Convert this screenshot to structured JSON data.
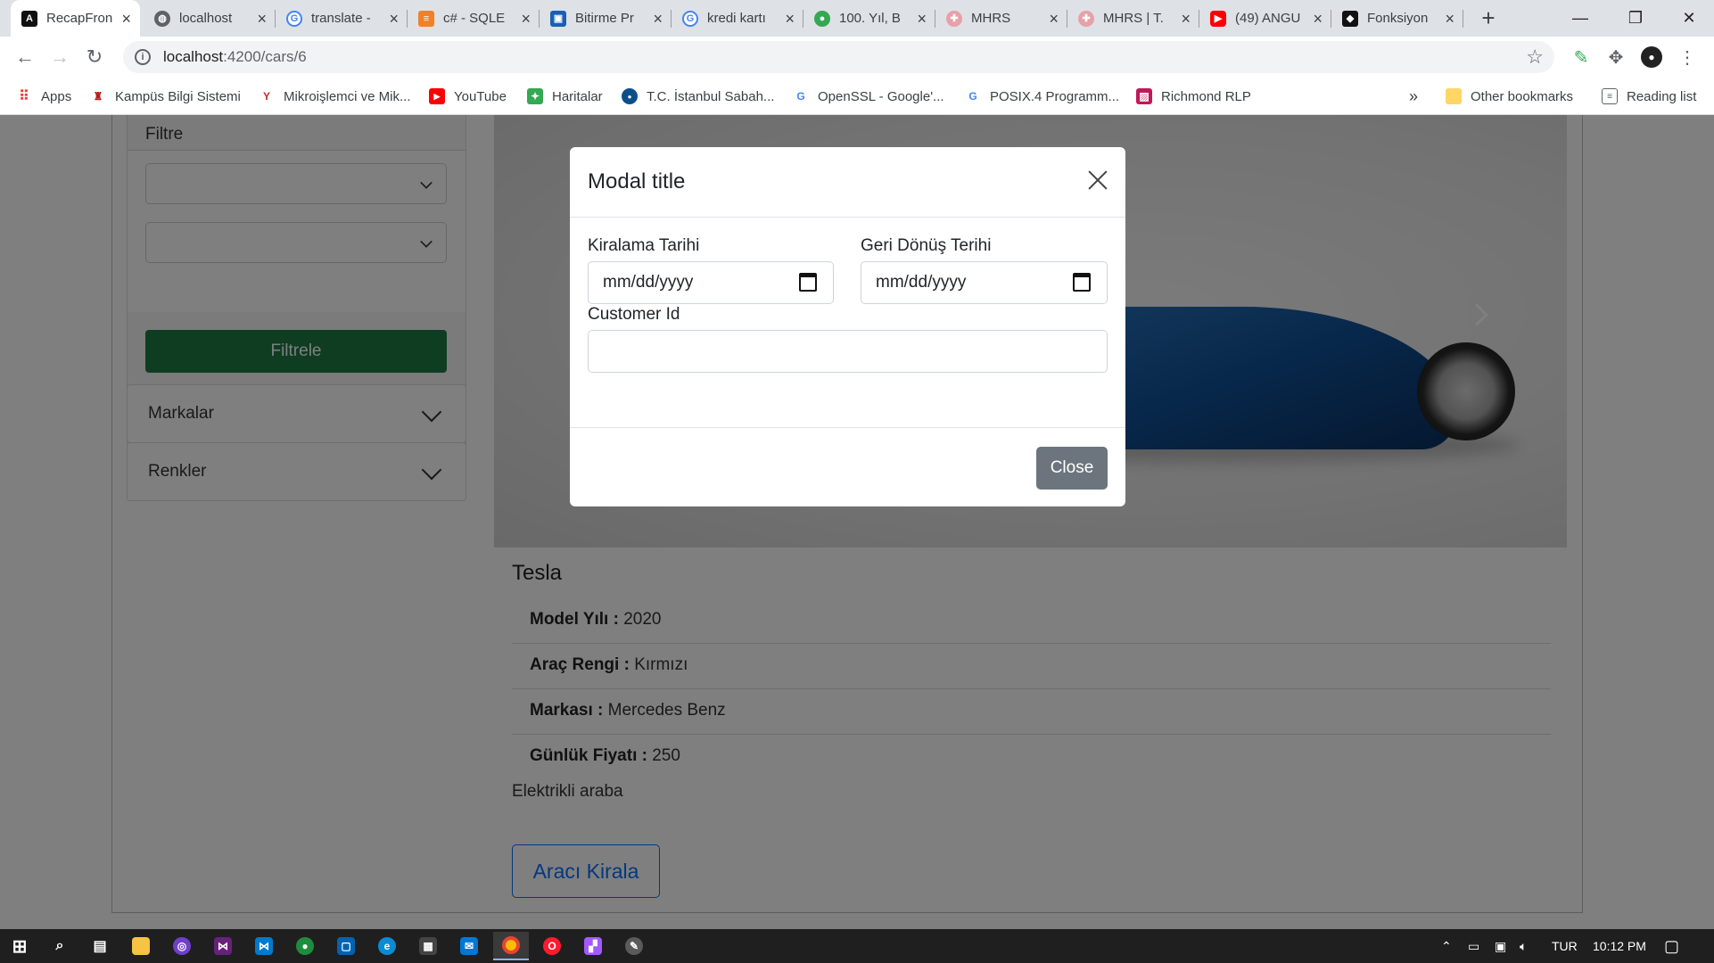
{
  "browser": {
    "tabs": [
      {
        "title": "RecapFron",
        "icon": "angular-icon",
        "active": true
      },
      {
        "title": "localhost",
        "icon": "globe-icon"
      },
      {
        "title": "translate -",
        "icon": "google-icon"
      },
      {
        "title": "c# - SQLE",
        "icon": "stackoverflow-icon"
      },
      {
        "title": "Bitirme Pr",
        "icon": "document-icon"
      },
      {
        "title": "kredi kartı",
        "icon": "google-icon"
      },
      {
        "title": "100. Yıl, B",
        "icon": "maps-pin-icon"
      },
      {
        "title": "MHRS",
        "icon": "mhrs-icon"
      },
      {
        "title": "MHRS | T.",
        "icon": "mhrs-icon"
      },
      {
        "title": "(49) ANGU",
        "icon": "youtube-icon"
      },
      {
        "title": "Fonksiyon",
        "icon": "site-icon"
      }
    ],
    "url_host": "localhost",
    "url_path": ":4200/cars/6",
    "bookmarks": [
      {
        "label": "Apps",
        "icon": "apps-grid-icon"
      },
      {
        "label": "Kampüs Bilgi Sistemi",
        "icon": "campus-icon"
      },
      {
        "label": "Mikroişlemci ve Mik...",
        "icon": "y-icon"
      },
      {
        "label": "YouTube",
        "icon": "youtube-icon"
      },
      {
        "label": "Haritalar",
        "icon": "maps-icon"
      },
      {
        "label": "T.C. İstanbul Sabah...",
        "icon": "university-icon"
      },
      {
        "label": "OpenSSL - Google'...",
        "icon": "google-icon"
      },
      {
        "label": "POSIX.4 Programm...",
        "icon": "google-icon"
      },
      {
        "label": "Richmond RLP",
        "icon": "richmond-icon"
      }
    ],
    "bookmarks_overflow": "»",
    "other_bookmarks": "Other bookmarks",
    "reading_list": "Reading list"
  },
  "sidebar": {
    "filter_title": "Filtre",
    "filter_button": "Filtrele",
    "brands_label": "Markalar",
    "colors_label": "Renkler"
  },
  "car": {
    "name": "Tesla",
    "fields": [
      {
        "label": "Model Yılı :",
        "value": "2020"
      },
      {
        "label": "Araç Rengi :",
        "value": "Kırmızı"
      },
      {
        "label": "Markası :",
        "value": "Mercedes Benz"
      },
      {
        "label": "Günlük Fiyatı :",
        "value": "250"
      }
    ],
    "description": "Elektrikli araba",
    "rent_button": "Aracı Kirala"
  },
  "modal": {
    "title": "Modal title",
    "rental_date_label": "Kiralama Tarihi",
    "rental_date_placeholder": "mm/dd/yyyy",
    "return_date_label": "Geri Dönüş Terihi",
    "return_date_placeholder": "mm/dd/yyyy",
    "customer_id_label": "Customer Id",
    "customer_id_value": "",
    "close_button": "Close"
  },
  "taskbar": {
    "language": "TUR",
    "time": "10:12 PM"
  },
  "colors": {
    "filter_button": "#1d7a45",
    "rent_button": "#0d6efd",
    "close_button": "#6c757d",
    "car_body": "#1f6fbf"
  }
}
